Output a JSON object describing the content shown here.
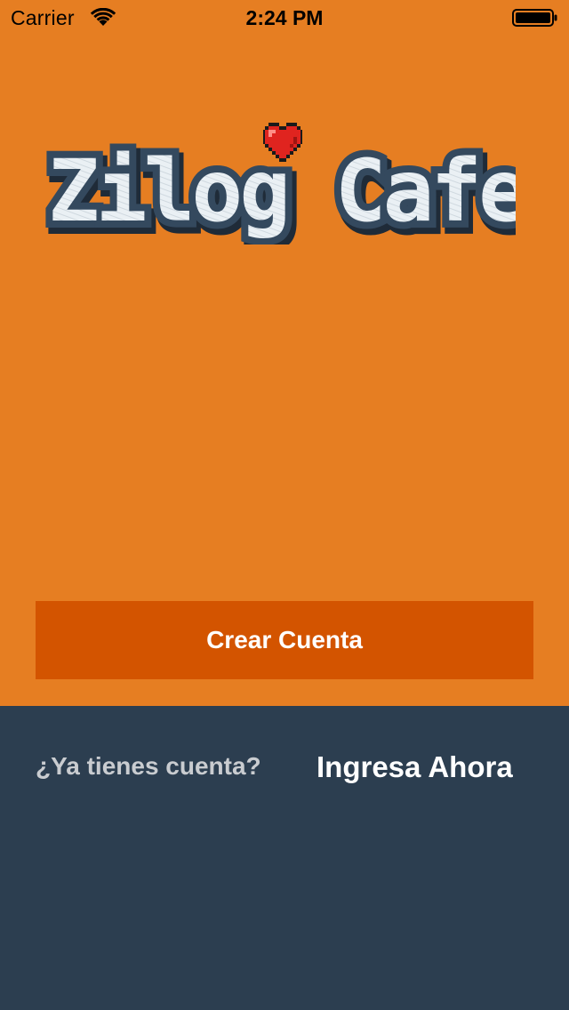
{
  "status_bar": {
    "carrier": "Carrier",
    "time": "2:24 PM",
    "wifi_icon": "wifi-icon",
    "battery_icon": "battery-icon"
  },
  "logo": {
    "text": "Zilog Cafe",
    "heart_icon": "heart-icon"
  },
  "colors": {
    "background": "#e67e22",
    "button": "#d35400",
    "panel": "#2c3e50",
    "logo_fill": "#e9eef2",
    "logo_outline": "#2f3f52",
    "heart": "#e0241f"
  },
  "create_account": {
    "label": "Crear Cuenta"
  },
  "login_prompt": {
    "question": "¿Ya tienes cuenta?",
    "link": "Ingresa Ahora"
  }
}
